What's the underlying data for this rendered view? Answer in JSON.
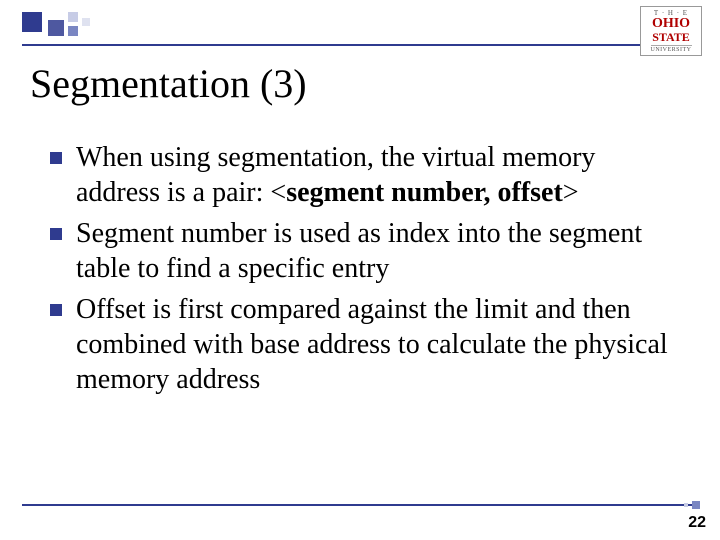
{
  "title": "Segmentation (3)",
  "logo": {
    "line1": "T · H · E",
    "line2": "OHIO",
    "line3": "STATE",
    "line4": "UNIVERSITY"
  },
  "bullets": [
    {
      "pre": "When using segmentation, the virtual memory address is a pair: <",
      "bold": "segment number, offset",
      "post": ">"
    },
    {
      "pre": "Segment number is used as index into the segment table to find a specific entry",
      "bold": "",
      "post": ""
    },
    {
      "pre": "Offset is first compared against the limit and then combined with base address to calculate the physical memory address",
      "bold": "",
      "post": ""
    }
  ],
  "page_number": "22"
}
